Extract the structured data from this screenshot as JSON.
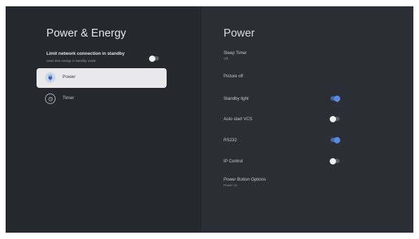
{
  "left": {
    "title": "Power & Energy",
    "limit_network": {
      "label": "Limit network connection in standby",
      "sub": "Uses less energy in standby mode",
      "toggle_on": false
    },
    "nav": [
      {
        "label": "Power",
        "icon": "power-plug-icon",
        "selected": true
      },
      {
        "label": "Timer",
        "icon": "timer-icon",
        "selected": false
      }
    ]
  },
  "right": {
    "title": "Power",
    "items": [
      {
        "label": "Sleep Timer",
        "sub": "Off"
      },
      {
        "label": "Picture off"
      },
      {
        "label": "Standby light",
        "toggle_on": true
      },
      {
        "label": "Auto start VCS",
        "toggle_on": false
      },
      {
        "label": "RS232",
        "toggle_on": true
      },
      {
        "label": "IP Control",
        "toggle_on": false
      },
      {
        "label": "Power Button Options",
        "sub": "Power on"
      }
    ]
  },
  "colors": {
    "screen_bg": "#25282d",
    "right_pane_bg": "#2b2e34",
    "selected_bg": "#e9e9ec",
    "toggle_on": "#5a8ae0",
    "toggle_off_knob": "#eef0f2"
  }
}
